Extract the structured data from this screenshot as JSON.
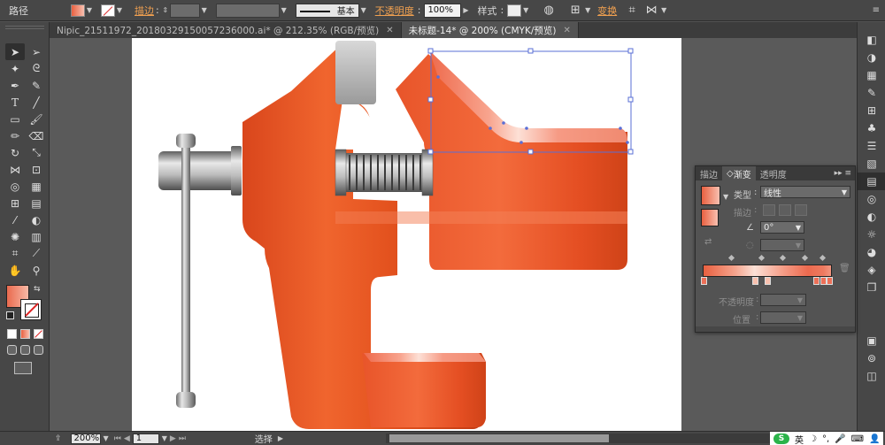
{
  "control_bar": {
    "object_label": "路径",
    "stroke_label": "描边",
    "stroke_style": "基本",
    "opacity_label": "不透明度",
    "opacity_value": "100%",
    "style_label": "样式",
    "transform_label": "变换"
  },
  "tabs": [
    {
      "label": "Nipic_21511972_20180329150057236000.ai* @ 212.35% (RGB/预览)",
      "close": "✕"
    },
    {
      "label": "未标题-14* @ 200% (CMYK/预览)",
      "close": "✕"
    }
  ],
  "gradient_panel": {
    "tabs": [
      "描边",
      "渐变",
      "透明度"
    ],
    "type_label": "类型",
    "type_value": "线性",
    "stroke_label": "描边",
    "angle_value": "0°",
    "opacity_label": "不透明度",
    "position_label": "位置"
  },
  "status_bar": {
    "zoom": "200%",
    "page": "1",
    "tool": "选择"
  },
  "ime": {
    "logo": "S",
    "lang": "英"
  },
  "colors": {
    "accent_orange": "#f0a050",
    "vise_orange": "#e85a2a",
    "selection_blue": "#5a6fd6"
  }
}
